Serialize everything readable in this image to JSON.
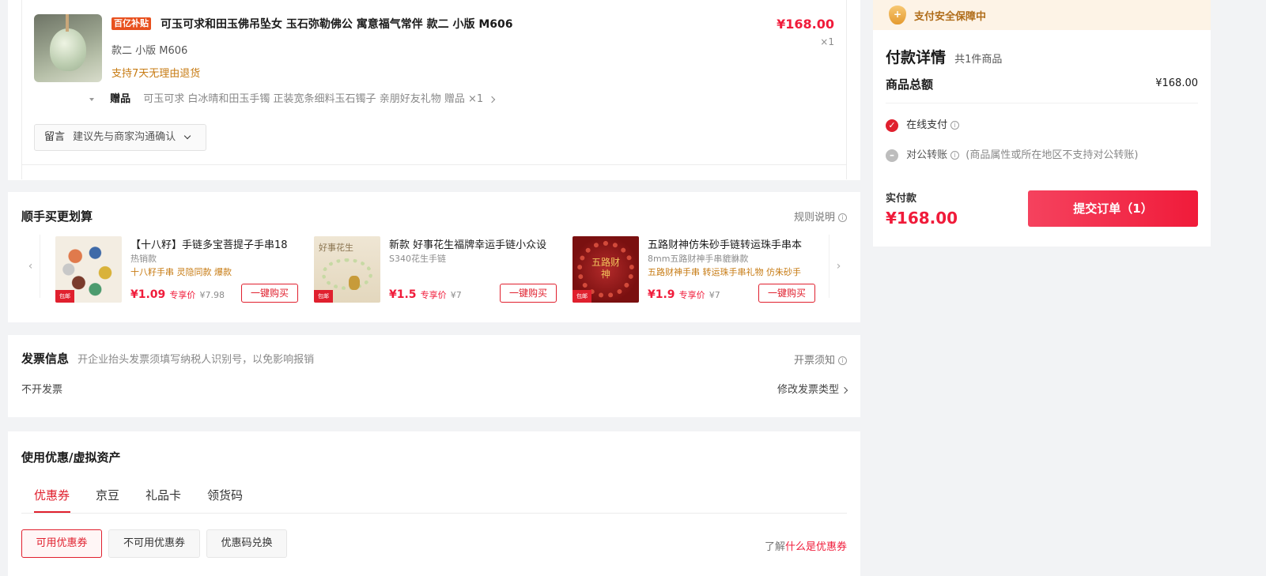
{
  "order_item": {
    "subsidy_badge": "百亿补贴",
    "title": "可玉可求和田玉佛吊坠女 玉石弥勒佛公 寓意福气常伴 款二 小版 M606",
    "price": "¥168.00",
    "quantity": "×1",
    "spec": "款二 小版 M606",
    "return_policy": "支持7天无理由退货",
    "gift_label": "赠品",
    "gift_text": "可玉可求 白冰晴和田玉手镯 正装宽条细料玉石镯子 亲朋好友礼物 赠品 ×1",
    "memo_label": "留言",
    "memo_text": "建议先与商家沟通确认"
  },
  "bundle": {
    "title": "顺手买更划算",
    "rules_link": "规则说明",
    "items": [
      {
        "title": "【十八籽】手链多宝菩提子手串18",
        "subtitle": "热销款",
        "tags": "十八籽手串 灵隐同款 爆款",
        "price": "¥1.09",
        "price_label": "专享价",
        "original": "¥7.98",
        "buy": "一键购买",
        "free_tag": "包邮"
      },
      {
        "title": "新款 好事花生福牌幸运手链小众设",
        "subtitle": "S340花生手链",
        "tags": "",
        "price": "¥1.5",
        "price_label": "专享价",
        "original": "¥7",
        "buy": "一键购买",
        "free_tag": "包邮",
        "img_text": "好事花生"
      },
      {
        "title": "五路财神仿朱砂手链转运珠手串本",
        "subtitle": "8mm五路财神手串貔貅款",
        "tags": "五路财神手串 转运珠手串礼物 仿朱砂手",
        "price": "¥1.9",
        "price_label": "专享价",
        "original": "¥7",
        "buy": "一键购买",
        "free_tag": "包邮",
        "img_text": "五路财神"
      }
    ]
  },
  "invoice": {
    "title": "发票信息",
    "hint": "开企业抬头发票须填写纳税人识别号，以免影响报销",
    "notice_link": "开票须知",
    "value": "不开发票",
    "modify_link": "修改发票类型"
  },
  "coupons": {
    "title": "使用优惠/虚拟资产",
    "tabs": [
      "优惠券",
      "京豆",
      "礼品卡",
      "领货码"
    ],
    "filters": [
      "可用优惠券",
      "不可用优惠券",
      "优惠码兑换"
    ],
    "learn_prefix": "了解",
    "learn_link": "什么是优惠券"
  },
  "sidebar": {
    "security_banner": "支付安全保障中",
    "title": "付款详情",
    "count_text": "共1件商品",
    "total_label": "商品总额",
    "total_value": "¥168.00",
    "pay_online": "在线支付",
    "pay_corporate": "对公转账",
    "corporate_note": "(商品属性或所在地区不支持对公转账)",
    "pay_label": "实付款",
    "pay_amount": "¥168.00",
    "submit": "提交订单（1）"
  },
  "colors": {
    "accent": "#f01b3a",
    "orange": "#c77b13",
    "banner_bg": "#fdf3e6"
  }
}
